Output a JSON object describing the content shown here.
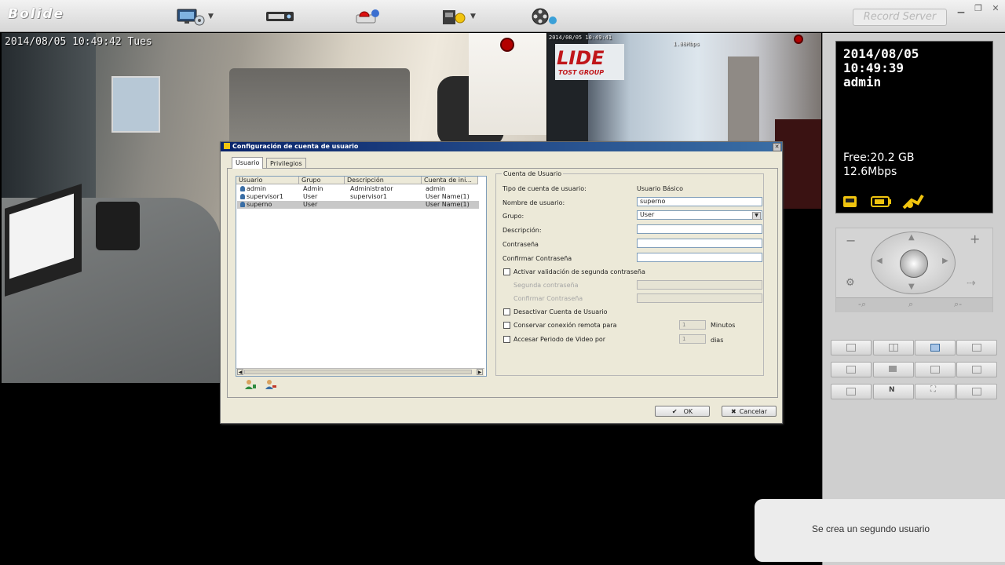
{
  "app": {
    "logo": "Bolide",
    "record_server": "Record Server"
  },
  "toolbar": {
    "icons": [
      "monitor-settings-icon",
      "dvr-device-icon",
      "alarm-icon",
      "folder-user-icon",
      "film-reel-icon"
    ]
  },
  "cameras": [
    {
      "timestamp": "2014/08/05 10:49:42 Tues",
      "recording": true
    },
    {
      "overlay": "2014/08/05 10:49:41",
      "bitrate": "1.00Mbps",
      "sign": "LIDE",
      "sign_sub": "TOST GROUP",
      "recording": true
    }
  ],
  "info": {
    "date": "2014/08/05",
    "time": "10:49:39",
    "user": "admin",
    "free": "Free:20.2 GB",
    "rate": "12.6Mbps"
  },
  "dialog": {
    "title": "Configuración de cuenta de usuario",
    "tabs": [
      "Usuario",
      "Privilegios"
    ],
    "columns": [
      "Usuario",
      "Grupo",
      "Descripción",
      "Cuenta de ini..."
    ],
    "users": [
      {
        "name": "admin",
        "group": "Admin",
        "description": "Administrator",
        "account": "admin"
      },
      {
        "name": "supervisor1",
        "group": "User",
        "description": "supervisor1",
        "account": "User Name(1)"
      },
      {
        "name": "superno",
        "group": "User",
        "description": "",
        "account": "User Name(1)"
      }
    ],
    "section_title": "Cuenta de Usuario",
    "labels": {
      "account_type": "Tipo de cuenta de usuario:",
      "account_type_value": "Usuario Básico",
      "username": "Nombre de usuario:",
      "group": "Grupo:",
      "description": "Descripción:",
      "password": "Contraseña",
      "confirm_password": "Confirmar Contraseña",
      "second_validation": "Activar validación de segunda contraseña",
      "second_password": "Segunda contraseña",
      "confirm_second": "Confirmar Contraseña",
      "disable_account": "Desactivar Cuenta de Usuario",
      "keep_remote": "Conservar conexión remota para",
      "minutes": "Minutos",
      "access_period": "Accesar Periodo de Video por",
      "days": "dias"
    },
    "values": {
      "username": "superno",
      "group": "User",
      "description": "",
      "keep_remote": "1",
      "access_period": "1"
    },
    "ok_label": "OK",
    "cancel_label": "Cancelar"
  },
  "toast": "Se crea un segundo usuario"
}
